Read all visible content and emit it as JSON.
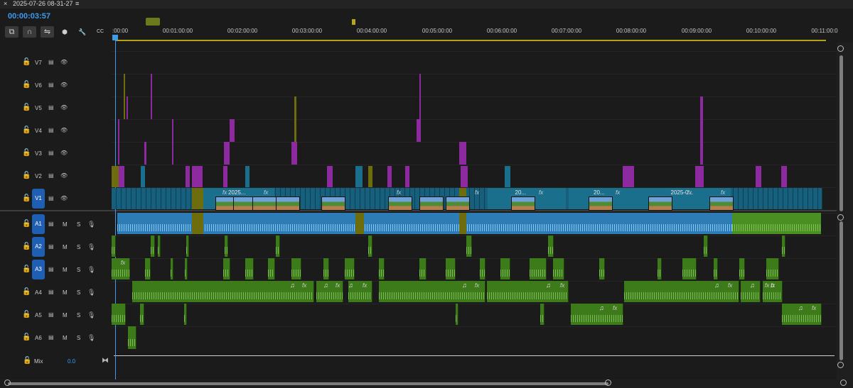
{
  "window": {
    "close_glyph": "×",
    "title": "2025-07-26 08-31-27",
    "menu_glyph": "≡"
  },
  "timecode": "00:00:03:57",
  "toolbar": {
    "insert_icon": "⧉",
    "magnet_icon": "∩",
    "linked_icon": "⇋",
    "marker_icon": "⬢",
    "wrench_icon": "🔧",
    "captions_icon": "CC"
  },
  "ruler": {
    "labels": [
      ":00:00",
      "00:01:00:00",
      "00:02:00:00",
      "00:03:00:00",
      "00:04:00:00",
      "00:05:00:00",
      "00:06:00:00",
      "00:07:00:00",
      "00:08:00:00",
      "00:09:00:00",
      "00:10:00:00",
      "00:11:00:0"
    ]
  },
  "video_tracks": [
    {
      "name": "V7"
    },
    {
      "name": "V6"
    },
    {
      "name": "V5"
    },
    {
      "name": "V4"
    },
    {
      "name": "V3"
    },
    {
      "name": "V2"
    },
    {
      "name": "V1",
      "targeted": true
    }
  ],
  "audio_tracks": [
    {
      "name": "A1",
      "targeted": true
    },
    {
      "name": "A2",
      "targeted": true
    },
    {
      "name": "A3",
      "targeted": true
    },
    {
      "name": "A4"
    },
    {
      "name": "A5"
    },
    {
      "name": "A6"
    }
  ],
  "track_controls": {
    "m": "M",
    "s": "S",
    "lock_glyph": "🔓",
    "eye_glyph": "👁",
    "sync_glyph": "▤",
    "mic_glyph": "🎙"
  },
  "mix": {
    "label": "Mix",
    "value": "0.0",
    "end_glyph": "⧓"
  },
  "clip_labels": {
    "c1": "2025...",
    "c2": "20...",
    "c3": "20...",
    "c4": "2025-0..."
  },
  "fx_label": "fx",
  "note_glyph": "♫",
  "colors": {
    "accent": "#3b9cf0",
    "video_clip": "#16607e",
    "audio_clip": "#3d7a1a",
    "adjustment": "#8d2aa0",
    "olive": "#6d6d0d"
  }
}
